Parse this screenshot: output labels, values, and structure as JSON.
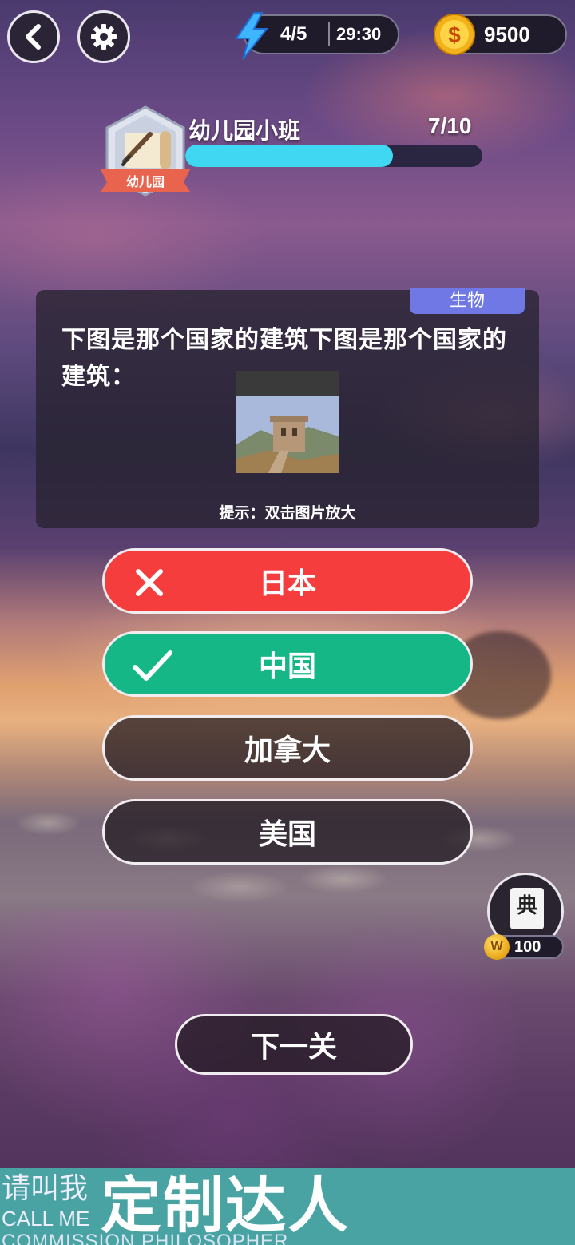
{
  "top_bar": {
    "back_icon": "chevron-left-icon",
    "settings_icon": "gear-icon",
    "energy": "4/5",
    "timer": "29:30",
    "coins": "9500"
  },
  "level": {
    "badge_label": "幼儿园",
    "title": "幼儿园小班",
    "count": "7/10",
    "progress": 0.7
  },
  "question": {
    "category": "生物",
    "text": "下图是那个国家的建筑下图是那个国家的建筑：",
    "hint": "提示：双击图片放大"
  },
  "answers": [
    {
      "label": "日本",
      "state": "wrong"
    },
    {
      "label": "中国",
      "state": "correct"
    },
    {
      "label": "加拿大",
      "state": "neutral"
    },
    {
      "label": "美国",
      "state": "neutral"
    }
  ],
  "dictionary": {
    "glyph": "典",
    "coin_letter": "W",
    "cost": "100"
  },
  "next_button": "下一关",
  "banner": {
    "line1": "请叫我",
    "line2": "CALL ME",
    "line3": "COMMISSION PHILOSOPHER",
    "big": "定制达人"
  },
  "colors": {
    "wrong": "#f53d3d",
    "correct": "#16b786",
    "progress": "#3fd7f2",
    "category": "#6f78e4"
  }
}
